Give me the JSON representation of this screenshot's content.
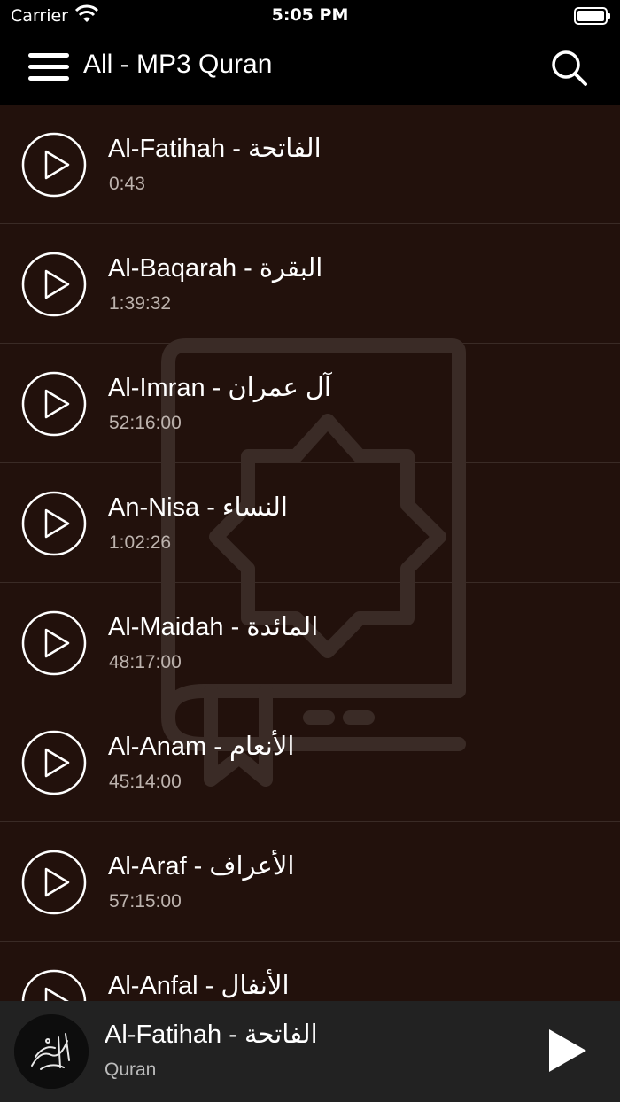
{
  "status": {
    "carrier": "Carrier",
    "time": "5:05 PM"
  },
  "nav": {
    "title": "All - MP3 Quran"
  },
  "tracks": [
    {
      "title": "Al-Fatihah - الفاتحة",
      "duration": "0:43"
    },
    {
      "title": "Al-Baqarah - البقرة",
      "duration": "1:39:32"
    },
    {
      "title": "Al-Imran - آل عمران",
      "duration": "52:16:00"
    },
    {
      "title": "An-Nisa - النساء",
      "duration": "1:02:26"
    },
    {
      "title": "Al-Maidah - المائدة",
      "duration": "48:17:00"
    },
    {
      "title": "Al-Anam - الأنعام",
      "duration": "45:14:00"
    },
    {
      "title": "Al-Araf - الأعراف",
      "duration": "57:15:00"
    },
    {
      "title": "Al-Anfal - الأنفال",
      "duration": ""
    }
  ],
  "player": {
    "title": "Al-Fatihah - الفاتحة",
    "subtitle": "Quran"
  },
  "colors": {
    "list_background": "#22110c",
    "bar_background": "#000000",
    "player_background": "#222222",
    "secondary_text": "#bdb3ae"
  }
}
